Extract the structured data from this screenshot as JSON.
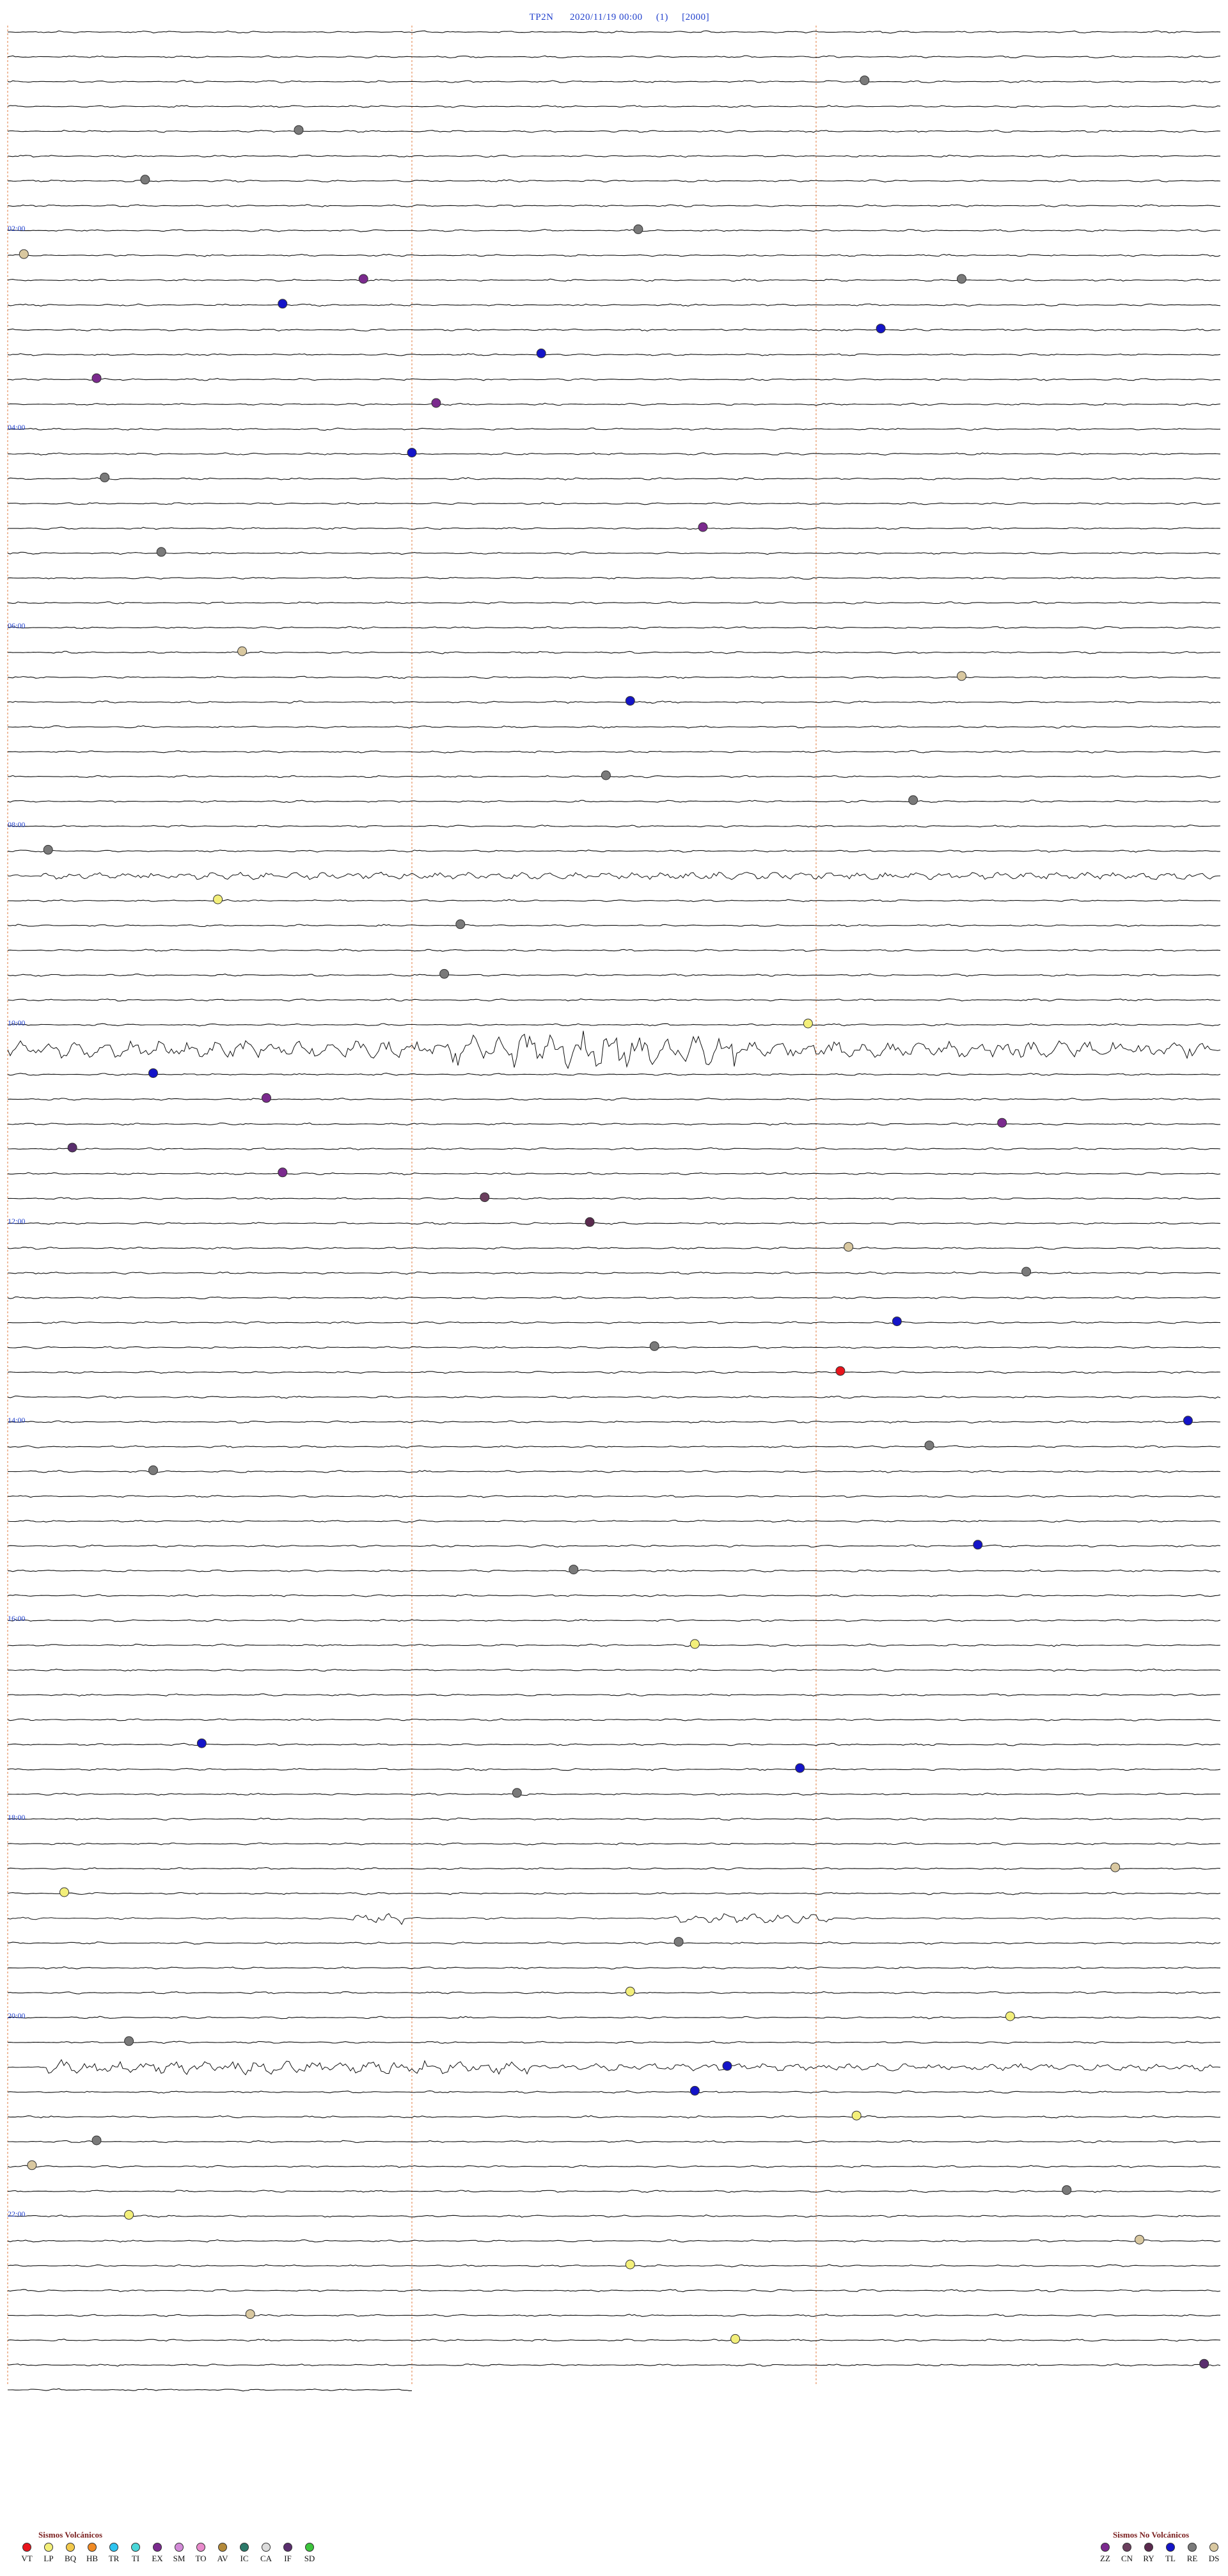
{
  "header": {
    "station": "TP2N",
    "datetime": "2020/11/19 00:00",
    "channel": "(1)",
    "scale": "[2000]"
  },
  "hour_labels": [
    "02:00",
    "04:00",
    "06:00",
    "08:00",
    "10:00",
    "12:00",
    "14:00",
    "16:00",
    "18:00",
    "20:00",
    "22:00"
  ],
  "legend": {
    "volcanic_title": "Sismos Volcánicos",
    "volcanic": [
      {
        "code": "VT",
        "color": "#e8141c"
      },
      {
        "code": "LP",
        "color": "#f3ef7a"
      },
      {
        "code": "BQ",
        "color": "#f2c94c"
      },
      {
        "code": "HB",
        "color": "#f08a24"
      },
      {
        "code": "TR",
        "color": "#2ec4f0"
      },
      {
        "code": "TI",
        "color": "#49d6d8"
      },
      {
        "code": "EX",
        "color": "#7b2a8e"
      },
      {
        "code": "SM",
        "color": "#d38ad8"
      },
      {
        "code": "TO",
        "color": "#e88acb"
      },
      {
        "code": "AV",
        "color": "#b48a3a"
      },
      {
        "code": "IC",
        "color": "#2c7a6a"
      },
      {
        "code": "CA",
        "color": "#dcdcdc"
      },
      {
        "code": "IF",
        "color": "#5a2e6e"
      },
      {
        "code": "SD",
        "color": "#3cc43c"
      }
    ],
    "nonvolcanic_title": "Sismos No Volcánicos",
    "nonvolcanic": [
      {
        "code": "ZZ",
        "color": "#7b2a8e"
      },
      {
        "code": "CN",
        "color": "#6b3f5e"
      },
      {
        "code": "RY",
        "color": "#5a2a4e"
      },
      {
        "code": "TL",
        "color": "#1414c8"
      },
      {
        "code": "RE",
        "color": "#7a7a7a"
      },
      {
        "code": "DS",
        "color": "#d9c8a0"
      }
    ]
  },
  "chart_data": {
    "type": "helicorder",
    "rows": 96,
    "minutes_per_row": 15,
    "start": "2020/11/19 00:00",
    "event_colors": {
      "VT": "#e8141c",
      "LP": "#f3ef7a",
      "EX": "#7b2a8e",
      "IF": "#5a2e6e",
      "TL": "#1414c8",
      "RE": "#7a7a7a",
      "DS": "#d9c8a0",
      "ZZ": "#7b2a8e",
      "CN": "#6b3f5e",
      "RY": "#5a2a4e"
    },
    "events": [
      {
        "row": 2,
        "minute": 10.6,
        "type": "RE"
      },
      {
        "row": 4,
        "minute": 3.6,
        "type": "RE"
      },
      {
        "row": 6,
        "minute": 1.7,
        "type": "RE"
      },
      {
        "row": 8,
        "minute": 7.8,
        "type": "RE"
      },
      {
        "row": 9,
        "minute": 0.2,
        "type": "DS"
      },
      {
        "row": 10,
        "minute": 4.4,
        "type": "EX"
      },
      {
        "row": 10,
        "minute": 11.8,
        "type": "RE"
      },
      {
        "row": 11,
        "minute": 3.4,
        "type": "TL"
      },
      {
        "row": 12,
        "minute": 10.8,
        "type": "TL"
      },
      {
        "row": 13,
        "minute": 6.6,
        "type": "TL"
      },
      {
        "row": 14,
        "minute": 1.1,
        "type": "EX"
      },
      {
        "row": 15,
        "minute": 5.3,
        "type": "EX"
      },
      {
        "row": 17,
        "minute": 5.0,
        "type": "TL"
      },
      {
        "row": 18,
        "minute": 1.2,
        "type": "RE"
      },
      {
        "row": 20,
        "minute": 8.6,
        "type": "EX"
      },
      {
        "row": 21,
        "minute": 1.9,
        "type": "RE"
      },
      {
        "row": 25,
        "minute": 2.9,
        "type": "DS"
      },
      {
        "row": 26,
        "minute": 11.8,
        "type": "DS"
      },
      {
        "row": 27,
        "minute": 7.7,
        "type": "TL"
      },
      {
        "row": 30,
        "minute": 7.4,
        "type": "RE"
      },
      {
        "row": 31,
        "minute": 11.2,
        "type": "RE"
      },
      {
        "row": 33,
        "minute": 0.5,
        "type": "RE"
      },
      {
        "row": 35,
        "minute": 2.6,
        "type": "LP"
      },
      {
        "row": 36,
        "minute": 5.6,
        "type": "RE"
      },
      {
        "row": 38,
        "minute": 5.4,
        "type": "RE"
      },
      {
        "row": 40,
        "minute": 9.9,
        "type": "LP"
      },
      {
        "row": 42,
        "minute": 1.8,
        "type": "TL"
      },
      {
        "row": 43,
        "minute": 3.2,
        "type": "EX"
      },
      {
        "row": 44,
        "minute": 12.3,
        "type": "EX"
      },
      {
        "row": 45,
        "minute": 0.8,
        "type": "IF"
      },
      {
        "row": 46,
        "minute": 3.4,
        "type": "ZZ"
      },
      {
        "row": 47,
        "minute": 5.9,
        "type": "CN"
      },
      {
        "row": 48,
        "minute": 7.2,
        "type": "RY"
      },
      {
        "row": 49,
        "minute": 10.4,
        "type": "DS"
      },
      {
        "row": 50,
        "minute": 12.6,
        "type": "RE"
      },
      {
        "row": 52,
        "minute": 11.0,
        "type": "TL"
      },
      {
        "row": 53,
        "minute": 8.0,
        "type": "RE"
      },
      {
        "row": 54,
        "minute": 10.3,
        "type": "VT"
      },
      {
        "row": 56,
        "minute": 14.6,
        "type": "TL"
      },
      {
        "row": 57,
        "minute": 11.4,
        "type": "RE"
      },
      {
        "row": 58,
        "minute": 1.8,
        "type": "RE"
      },
      {
        "row": 61,
        "minute": 12.0,
        "type": "TL"
      },
      {
        "row": 62,
        "minute": 7.0,
        "type": "RE"
      },
      {
        "row": 65,
        "minute": 8.5,
        "type": "LP"
      },
      {
        "row": 69,
        "minute": 2.4,
        "type": "TL"
      },
      {
        "row": 70,
        "minute": 9.8,
        "type": "TL"
      },
      {
        "row": 71,
        "minute": 6.3,
        "type": "RE"
      },
      {
        "row": 74,
        "minute": 13.7,
        "type": "DS"
      },
      {
        "row": 75,
        "minute": 0.7,
        "type": "LP"
      },
      {
        "row": 77,
        "minute": 8.3,
        "type": "RE"
      },
      {
        "row": 79,
        "minute": 7.7,
        "type": "LP"
      },
      {
        "row": 80,
        "minute": 12.4,
        "type": "LP"
      },
      {
        "row": 81,
        "minute": 1.5,
        "type": "RE"
      },
      {
        "row": 82,
        "minute": 8.9,
        "type": "TL"
      },
      {
        "row": 83,
        "minute": 8.5,
        "type": "TL"
      },
      {
        "row": 84,
        "minute": 10.5,
        "type": "LP"
      },
      {
        "row": 85,
        "minute": 1.1,
        "type": "RE"
      },
      {
        "row": 86,
        "minute": 0.3,
        "type": "DS"
      },
      {
        "row": 87,
        "minute": 13.1,
        "type": "RE"
      },
      {
        "row": 88,
        "minute": 1.5,
        "type": "LP"
      },
      {
        "row": 89,
        "minute": 14.0,
        "type": "DS"
      },
      {
        "row": 90,
        "minute": 7.7,
        "type": "LP"
      },
      {
        "row": 92,
        "minute": 3.0,
        "type": "DS"
      },
      {
        "row": 93,
        "minute": 9.0,
        "type": "LP"
      },
      {
        "row": 94,
        "minute": 14.8,
        "type": "IF"
      }
    ]
  }
}
